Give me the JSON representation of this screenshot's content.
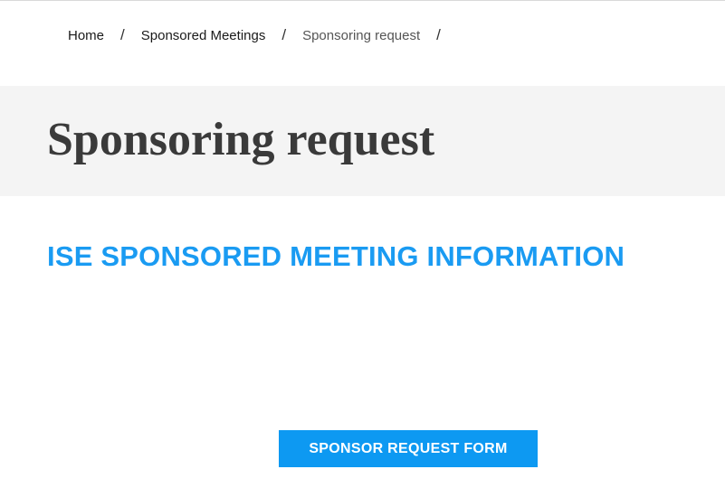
{
  "breadcrumb": {
    "items": [
      {
        "label": "Home"
      },
      {
        "label": "Sponsored Meetings"
      },
      {
        "label": "Sponsoring request"
      }
    ],
    "separator": "/"
  },
  "page": {
    "title": "Sponsoring request",
    "section_heading": "ISE SPONSORED MEETING INFORMATION",
    "cta_label": "SPONSOR REQUEST FORM"
  },
  "colors": {
    "accent": "#1a9bf2",
    "button_bg": "#0d99f2",
    "title_band": "#f4f4f4",
    "title_text": "#3a3a3a"
  }
}
